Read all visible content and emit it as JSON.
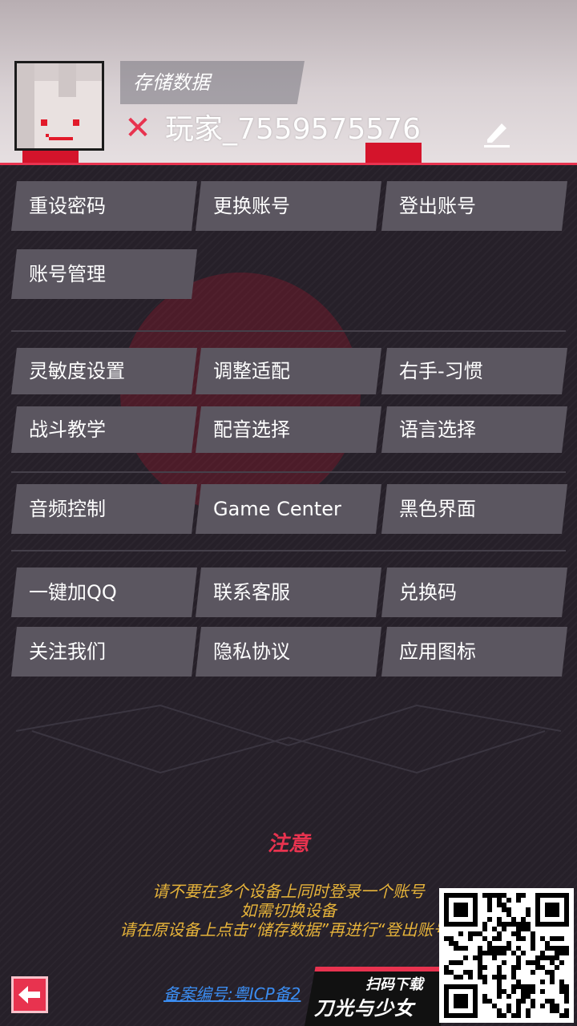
{
  "header": {
    "save_label": "存储数据",
    "player_name": "玩家_7559575576"
  },
  "account_buttons": [
    "重设密码",
    "更换账号",
    "登出账号",
    "账号管理"
  ],
  "settings_buttons": [
    "灵敏度设置",
    "调整适配",
    "右手-习惯",
    "战斗教学",
    "配音选择",
    "语言选择"
  ],
  "media_buttons": [
    "音频控制",
    "Game Center",
    "黑色界面"
  ],
  "social_buttons": [
    "一键加QQ",
    "联系客服",
    "兑换码",
    "关注我们",
    "隐私协议",
    "应用图标"
  ],
  "notice": {
    "title": "注意",
    "line1": "请不要在多个设备上同时登录一个账号",
    "line2": "如需切换设备",
    "line3": "请在原设备上点击“储存数据”再进行“登出账号”"
  },
  "footer": {
    "icp": "备案编号:粤ICP备2",
    "promo_scan": "扫码下载",
    "promo_game": "刀光与少女"
  },
  "colors": {
    "accent": "#e8334f",
    "button": "#5b5660",
    "notice_text": "#e6b33a",
    "link": "#3b8cf0"
  }
}
